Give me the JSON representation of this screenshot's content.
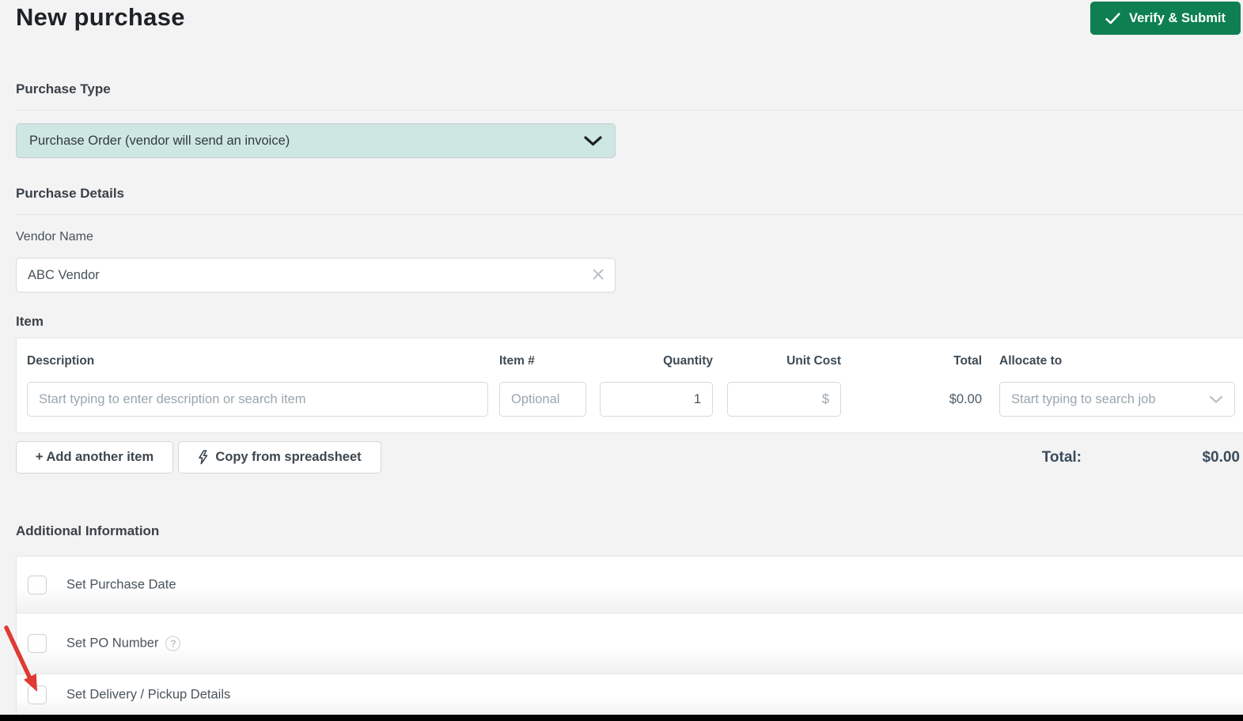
{
  "page": {
    "title": "New purchase"
  },
  "header": {
    "submit_label": "Verify & Submit"
  },
  "purchase_type": {
    "section_label": "Purchase Type",
    "selected_option": "Purchase Order (vendor will send an invoice)"
  },
  "purchase_details": {
    "section_label": "Purchase Details",
    "vendor_label": "Vendor Name",
    "vendor_value": "ABC Vendor"
  },
  "item_section": {
    "section_label": "Item",
    "columns": {
      "description": "Description",
      "item_number": "Item #",
      "quantity": "Quantity",
      "unit_cost": "Unit Cost",
      "total": "Total",
      "allocate_to": "Allocate to"
    },
    "row": {
      "description_placeholder": "Start typing to enter description or search item",
      "item_number_placeholder": "Optional",
      "quantity_value": "1",
      "unit_cost_placeholder": "$",
      "total_value": "$0.00",
      "allocate_placeholder": "Start typing to search job"
    },
    "add_item_label": "+ Add another item",
    "copy_label": "Copy from spreadsheet",
    "grand_total_label": "Total:",
    "grand_total_value": "$0.00"
  },
  "additional_info": {
    "section_label": "Additional Information",
    "options": [
      {
        "label": "Set Purchase Date",
        "checked": false
      },
      {
        "label": "Set PO Number",
        "checked": false,
        "help_text": "?"
      },
      {
        "label": "Set Delivery / Pickup Details",
        "checked": false
      }
    ]
  },
  "annotation": {
    "type": "red-arrow",
    "color": "#e03a34"
  },
  "colors": {
    "page_bg": "#f3f3f4",
    "accent_green": "#0d7f51",
    "select_teal_bg": "#cfe7e2",
    "text_dark": "#3a4147",
    "placeholder_gray": "#9aa6ad",
    "bottom_bar": "#000000"
  }
}
